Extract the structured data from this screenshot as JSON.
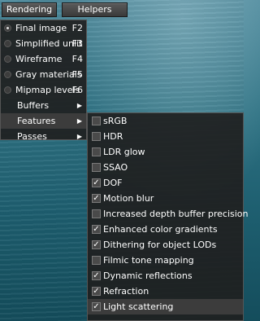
{
  "menubar": {
    "rendering": "Rendering",
    "helpers": "Helpers"
  },
  "rendering_menu": {
    "modes": [
      {
        "label": "Final image",
        "shortcut": "F2",
        "selected": true
      },
      {
        "label": "Simplified unlit",
        "shortcut": "F3",
        "selected": false
      },
      {
        "label": "Wireframe",
        "shortcut": "F4",
        "selected": false
      },
      {
        "label": "Gray materials",
        "shortcut": "F5",
        "selected": false
      },
      {
        "label": "Mipmap levels",
        "shortcut": "F6",
        "selected": false
      }
    ],
    "submenus": [
      "Buffers",
      "Features",
      "Passes"
    ]
  },
  "features_menu": {
    "items": [
      {
        "label": "sRGB",
        "checked": false
      },
      {
        "label": "HDR",
        "checked": false
      },
      {
        "label": "LDR glow",
        "checked": false
      },
      {
        "label": "SSAO",
        "checked": false
      },
      {
        "label": "DOF",
        "checked": true
      },
      {
        "label": "Motion blur",
        "checked": true
      },
      {
        "label": "Increased depth buffer precision",
        "checked": false
      },
      {
        "label": "Enhanced color gradients",
        "checked": true
      },
      {
        "label": "Dithering for object LODs",
        "checked": true
      },
      {
        "label": "Filmic tone mapping",
        "checked": false
      },
      {
        "label": "Dynamic reflections",
        "checked": true
      },
      {
        "label": "Refraction",
        "checked": true
      },
      {
        "label": "Light scattering",
        "checked": true
      }
    ]
  },
  "icons": {
    "submenu_arrow": "triangle-right-icon",
    "check_mark": "✓"
  }
}
